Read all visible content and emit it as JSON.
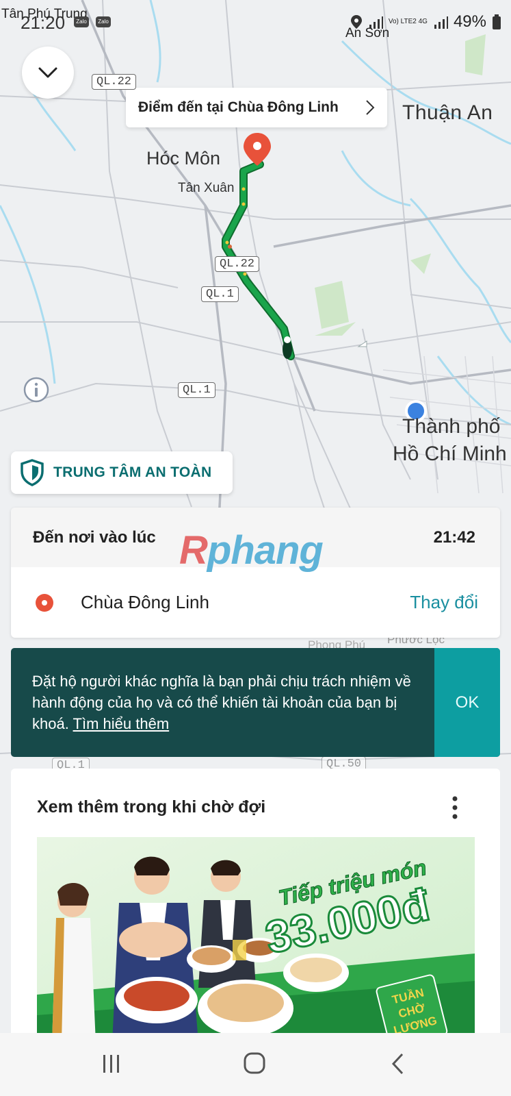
{
  "status_bar": {
    "place_left": "Tân Phú Trung",
    "time": "21:20",
    "app_icons": [
      "Zalo",
      "Zalo"
    ],
    "network": "Vo) LTE2 4G",
    "battery": "49%",
    "place_right": "An Sơn"
  },
  "map": {
    "destination_chip": "Điểm đến tại Chùa Đông Linh",
    "labels": {
      "hoc_mon": "Hóc Môn",
      "tan_xuan": "Tân Xuân",
      "thuan_an": "Thuận An",
      "hcm_line1": "Thành phố",
      "hcm_line2": "Hồ Chí Minh",
      "phong_phu": "Phong Phú",
      "phuoc_loc": "Phước Lộc"
    },
    "road_shields": [
      "QL.22",
      "QL.22",
      "QL.1",
      "QL.1",
      "QL.1",
      "QL.50"
    ],
    "route_color": "#1aa44b",
    "destination_pin_color": "#e8523a",
    "current_location_color": "#3b82e0"
  },
  "safety_center": {
    "label": "TRUNG TÂM AN TOÀN",
    "accent": "#0b6e70"
  },
  "eta_card": {
    "heading": "Đến nơi vào lúc",
    "arrival_time": "21:42",
    "destination": "Chùa Đông Linh",
    "change_label": "Thay đổi"
  },
  "watermark": {
    "text_a": "R",
    "text_b": "phang"
  },
  "notice": {
    "message": "Đặt hộ người khác nghĩa là bạn phải chịu trách nhiệm về hành động của họ và có thể khiến tài khoản của bạn bị khoá.",
    "link": "Tìm hiểu thêm",
    "ok_label": "OK"
  },
  "more_section": {
    "title": "Xem thêm trong khi chờ đợi",
    "promo": {
      "headline": "Tiếp triệu món",
      "price": "33.000đ",
      "badge_line1": "TUẦN",
      "badge_line2": "CHỜ",
      "badge_line3": "LƯƠNG"
    }
  }
}
